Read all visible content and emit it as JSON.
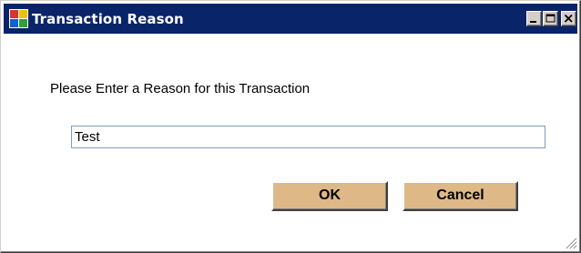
{
  "window": {
    "title": "Transaction Reason",
    "icon": "app-icon",
    "controls": [
      "minimize-icon",
      "maximize-icon",
      "close-icon"
    ],
    "titlebar_color": "#0a246a"
  },
  "dialog": {
    "prompt": "Please Enter a Reason for this Transaction",
    "reason_value": "Test",
    "ok_label": "OK",
    "cancel_label": "Cancel",
    "button_color": "#deb887"
  }
}
